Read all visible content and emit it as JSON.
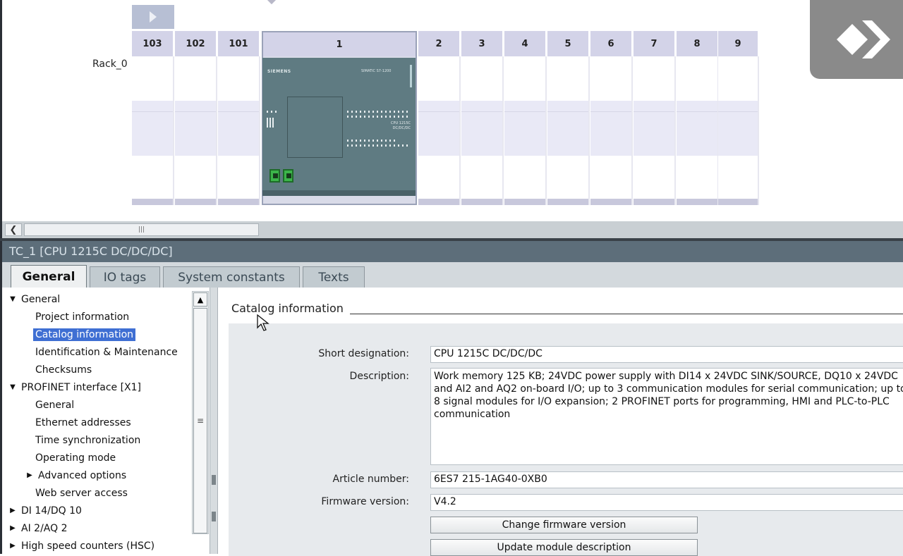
{
  "device_view": {
    "rack_label": "Rack_0",
    "slots": [
      "103",
      "102",
      "101",
      "1",
      "2",
      "3",
      "4",
      "5",
      "6",
      "7",
      "8",
      "9"
    ],
    "cpu": {
      "brand": "SIEMENS",
      "model": "SIMATIC S7-1200",
      "label_line1": "CPU 1215C",
      "label_line2": "DC/DC/DC"
    }
  },
  "inspector": {
    "title": "TC_1 [CPU 1215C DC/DC/DC]",
    "tabs": [
      "General",
      "IO tags",
      "System constants",
      "Texts"
    ]
  },
  "tree": {
    "items": [
      {
        "label": "General",
        "expander": "expanded"
      },
      {
        "label": "Project information"
      },
      {
        "label": "Catalog information",
        "selected": true
      },
      {
        "label": "Identification & Maintenance"
      },
      {
        "label": "Checksums"
      },
      {
        "label": "PROFINET interface [X1]",
        "expander": "expanded"
      },
      {
        "label": "General"
      },
      {
        "label": "Ethernet addresses"
      },
      {
        "label": "Time synchronization"
      },
      {
        "label": "Operating mode"
      },
      {
        "label": "Advanced options",
        "expander": "collapsed"
      },
      {
        "label": "Web server access"
      },
      {
        "label": "DI 14/DQ 10",
        "expander": "collapsed"
      },
      {
        "label": "AI 2/AQ 2",
        "expander": "collapsed"
      },
      {
        "label": "High speed counters (HSC)",
        "expander": "collapsed"
      }
    ]
  },
  "catalog": {
    "section_title": "Catalog information",
    "short_designation_label": "Short designation:",
    "short_designation": "CPU 1215C DC/DC/DC",
    "description_label": "Description:",
    "description": "Work memory 125 KB; 24VDC power supply with DI14 x 24VDC SINK/SOURCE, DQ10 x 24VDC and AI2 and AQ2 on-board I/O; up to 3 communication modules for serial communication; up to 8 signal modules for I/O expansion; 2 PROFINET ports for programming, HMI and PLC-to-PLC communication",
    "article_number_label": "Article number:",
    "article_number": "6ES7 215-1AG40-0XB0",
    "firmware_version_label": "Firmware version:",
    "firmware_version": "V4.2",
    "change_firmware_button": "Change firmware version",
    "update_description_button": "Update module description"
  },
  "colors": {
    "selection": "#3f6fd3",
    "title_bar": "#5d6e7a",
    "cpu_body": "#5f7b82",
    "port_green": "#3cb54a"
  }
}
